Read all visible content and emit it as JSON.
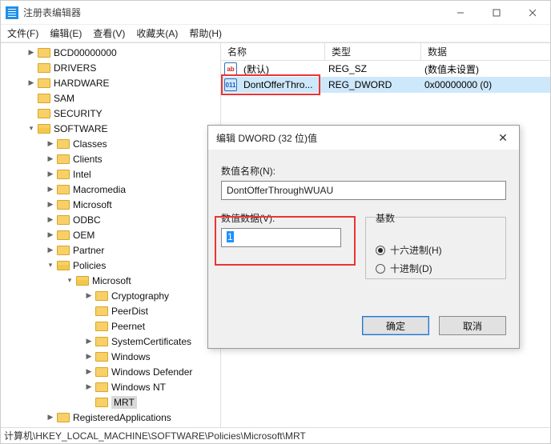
{
  "window": {
    "title": "注册表编辑器"
  },
  "menu": {
    "file": "文件(F)",
    "edit": "编辑(E)",
    "view": "查看(V)",
    "favorites": "收藏夹(A)",
    "help": "帮助(H)"
  },
  "tree": {
    "bcd": "BCD00000000",
    "drivers": "DRIVERS",
    "hardware": "HARDWARE",
    "sam": "SAM",
    "security": "SECURITY",
    "software": "SOFTWARE",
    "classes": "Classes",
    "clients": "Clients",
    "intel": "Intel",
    "macromedia": "Macromedia",
    "microsoft": "Microsoft",
    "odbc": "ODBC",
    "oem": "OEM",
    "partner": "Partner",
    "policies": "Policies",
    "pol_ms": "Microsoft",
    "cryptography": "Cryptography",
    "peerdist": "PeerDist",
    "peernet": "Peernet",
    "syscert": "SystemCertificates",
    "windows": "Windows",
    "windef": "Windows Defender",
    "winnt": "Windows NT",
    "mrt": "MRT",
    "regapps": "RegisteredApplications"
  },
  "list": {
    "col_name": "名称",
    "col_type": "类型",
    "col_data": "数据",
    "row0": {
      "name": "(默认)",
      "type": "REG_SZ",
      "data": "(数值未设置)"
    },
    "row1": {
      "name": "DontOfferThro...",
      "type": "REG_DWORD",
      "data": "0x00000000 (0)"
    }
  },
  "dialog": {
    "title": "编辑 DWORD (32 位)值",
    "name_label": "数值名称(N):",
    "name_value": "DontOfferThroughWUAU",
    "data_label": "数值数据(V):",
    "data_value": "1",
    "base_label": "基数",
    "radix_hex": "十六进制(H)",
    "radix_dec": "十进制(D)",
    "ok": "确定",
    "cancel": "取消"
  },
  "status": {
    "path": "计算机\\HKEY_LOCAL_MACHINE\\SOFTWARE\\Policies\\Microsoft\\MRT"
  }
}
